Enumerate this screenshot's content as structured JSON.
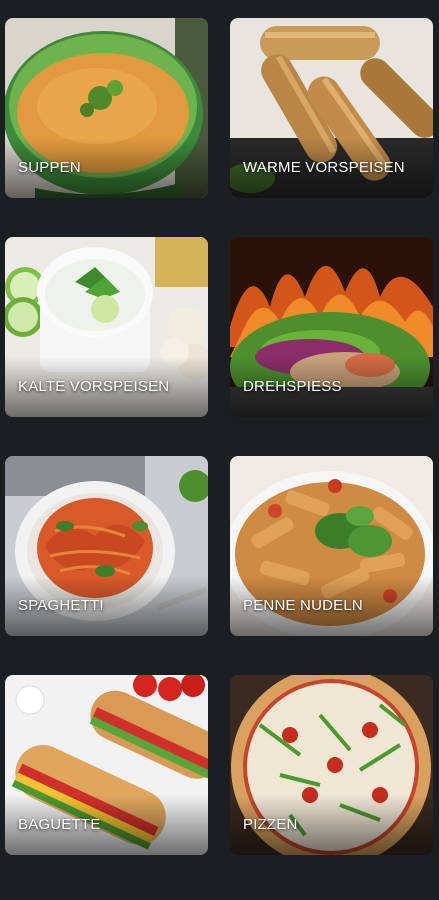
{
  "categories": [
    {
      "label": "SUPPEN"
    },
    {
      "label": "WARME VORSPEISEN"
    },
    {
      "label": "KALTE VORSPEISEN"
    },
    {
      "label": "DREHSPIESS"
    },
    {
      "label": "SPAGHETTI"
    },
    {
      "label": "PENNE NUDELN"
    },
    {
      "label": "BAGUETTE"
    },
    {
      "label": "PIZZEN"
    }
  ]
}
